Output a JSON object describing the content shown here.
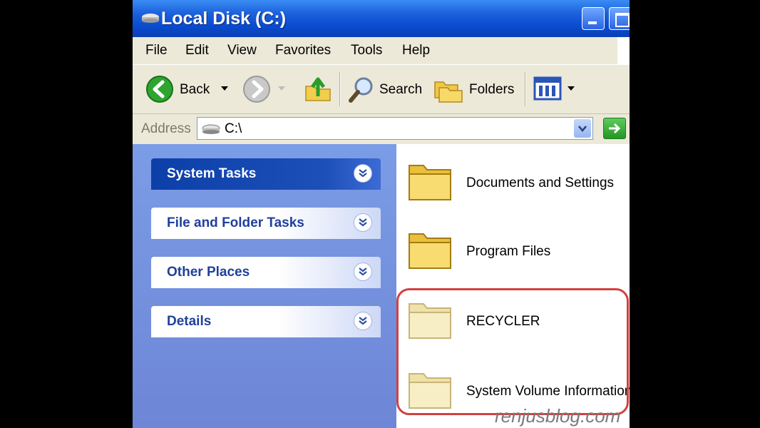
{
  "window": {
    "title": "Local Disk (C:)"
  },
  "menu": [
    "File",
    "Edit",
    "View",
    "Favorites",
    "Tools",
    "Help"
  ],
  "toolbar": {
    "back_label": "Back",
    "search_label": "Search",
    "folders_label": "Folders"
  },
  "address": {
    "label": "Address",
    "value": "C:\\"
  },
  "tasks": [
    {
      "label": "System Tasks"
    },
    {
      "label": "File and Folder Tasks"
    },
    {
      "label": "Other Places"
    },
    {
      "label": "Details"
    }
  ],
  "files": [
    {
      "name": "Documents and Settings",
      "hidden": false
    },
    {
      "name": "Program Files",
      "hidden": false
    },
    {
      "name": "RECYCLER",
      "hidden": true
    },
    {
      "name": "System Volume Information",
      "hidden": true
    }
  ],
  "watermark": "renjusblog.com",
  "colors": {
    "titlebar": "#0a4bd0",
    "taskpane": "#7b9ce6",
    "highlight": "#d24040"
  }
}
